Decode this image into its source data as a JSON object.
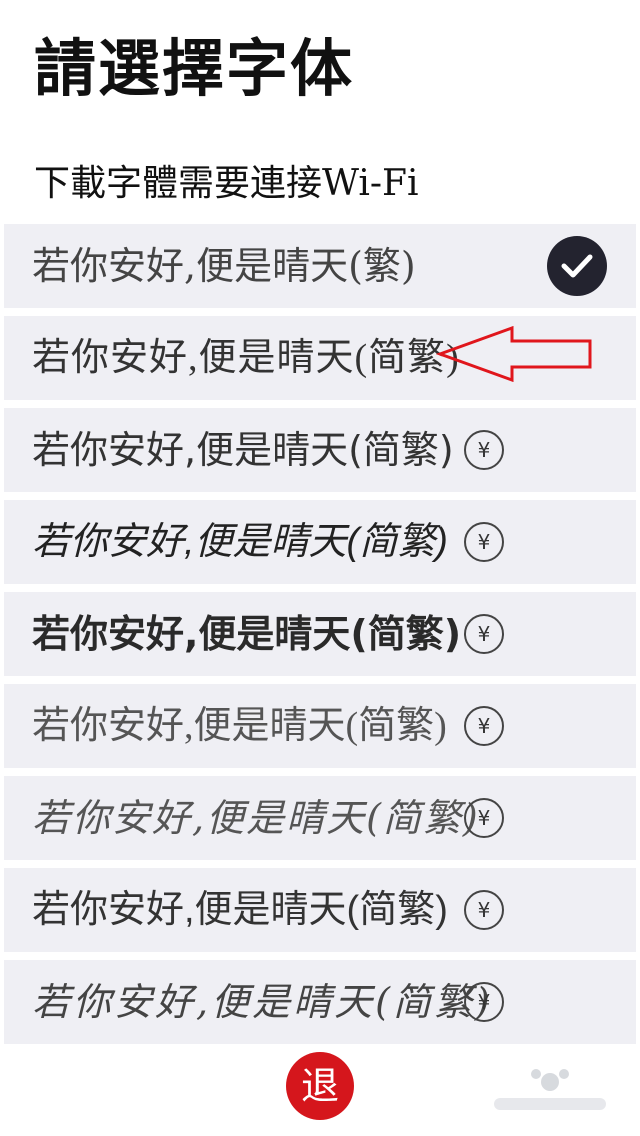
{
  "header": {
    "title": "請選擇字体",
    "subtitle": "下載字體需要連接Wi-Fi"
  },
  "font_list": {
    "items": [
      {
        "label": "若你安好,便是晴天(繁)",
        "status": "selected",
        "icon": "check-icon"
      },
      {
        "label": "若你安好,便是晴天(简繁)",
        "status": "free",
        "icon": ""
      },
      {
        "label": "若你安好,便是晴天(简繁)",
        "status": "paid",
        "icon": "yen-icon"
      },
      {
        "label": "若你安好,便是晴天(简繁)",
        "status": "paid",
        "icon": "yen-icon"
      },
      {
        "label": "若你安好,便是晴天(简繁)",
        "status": "paid",
        "icon": "yen-icon"
      },
      {
        "label": "若你安好,便是晴天(简繁)",
        "status": "paid",
        "icon": "yen-icon"
      },
      {
        "label": "若你安好,便是晴天(简繁)",
        "status": "paid",
        "icon": "yen-icon"
      },
      {
        "label": "若你安好,便是晴天(简繁)",
        "status": "paid",
        "icon": "yen-icon"
      },
      {
        "label": "若你安好,便是晴天(简繁)",
        "status": "paid",
        "icon": "yen-icon"
      }
    ],
    "price_symbol": "¥"
  },
  "footer": {
    "exit_label": "退"
  },
  "colors": {
    "row_background": "#efeff4",
    "check_background": "#23232f",
    "exit_button": "#d5161c",
    "annotation_arrow": "#e0161c"
  }
}
